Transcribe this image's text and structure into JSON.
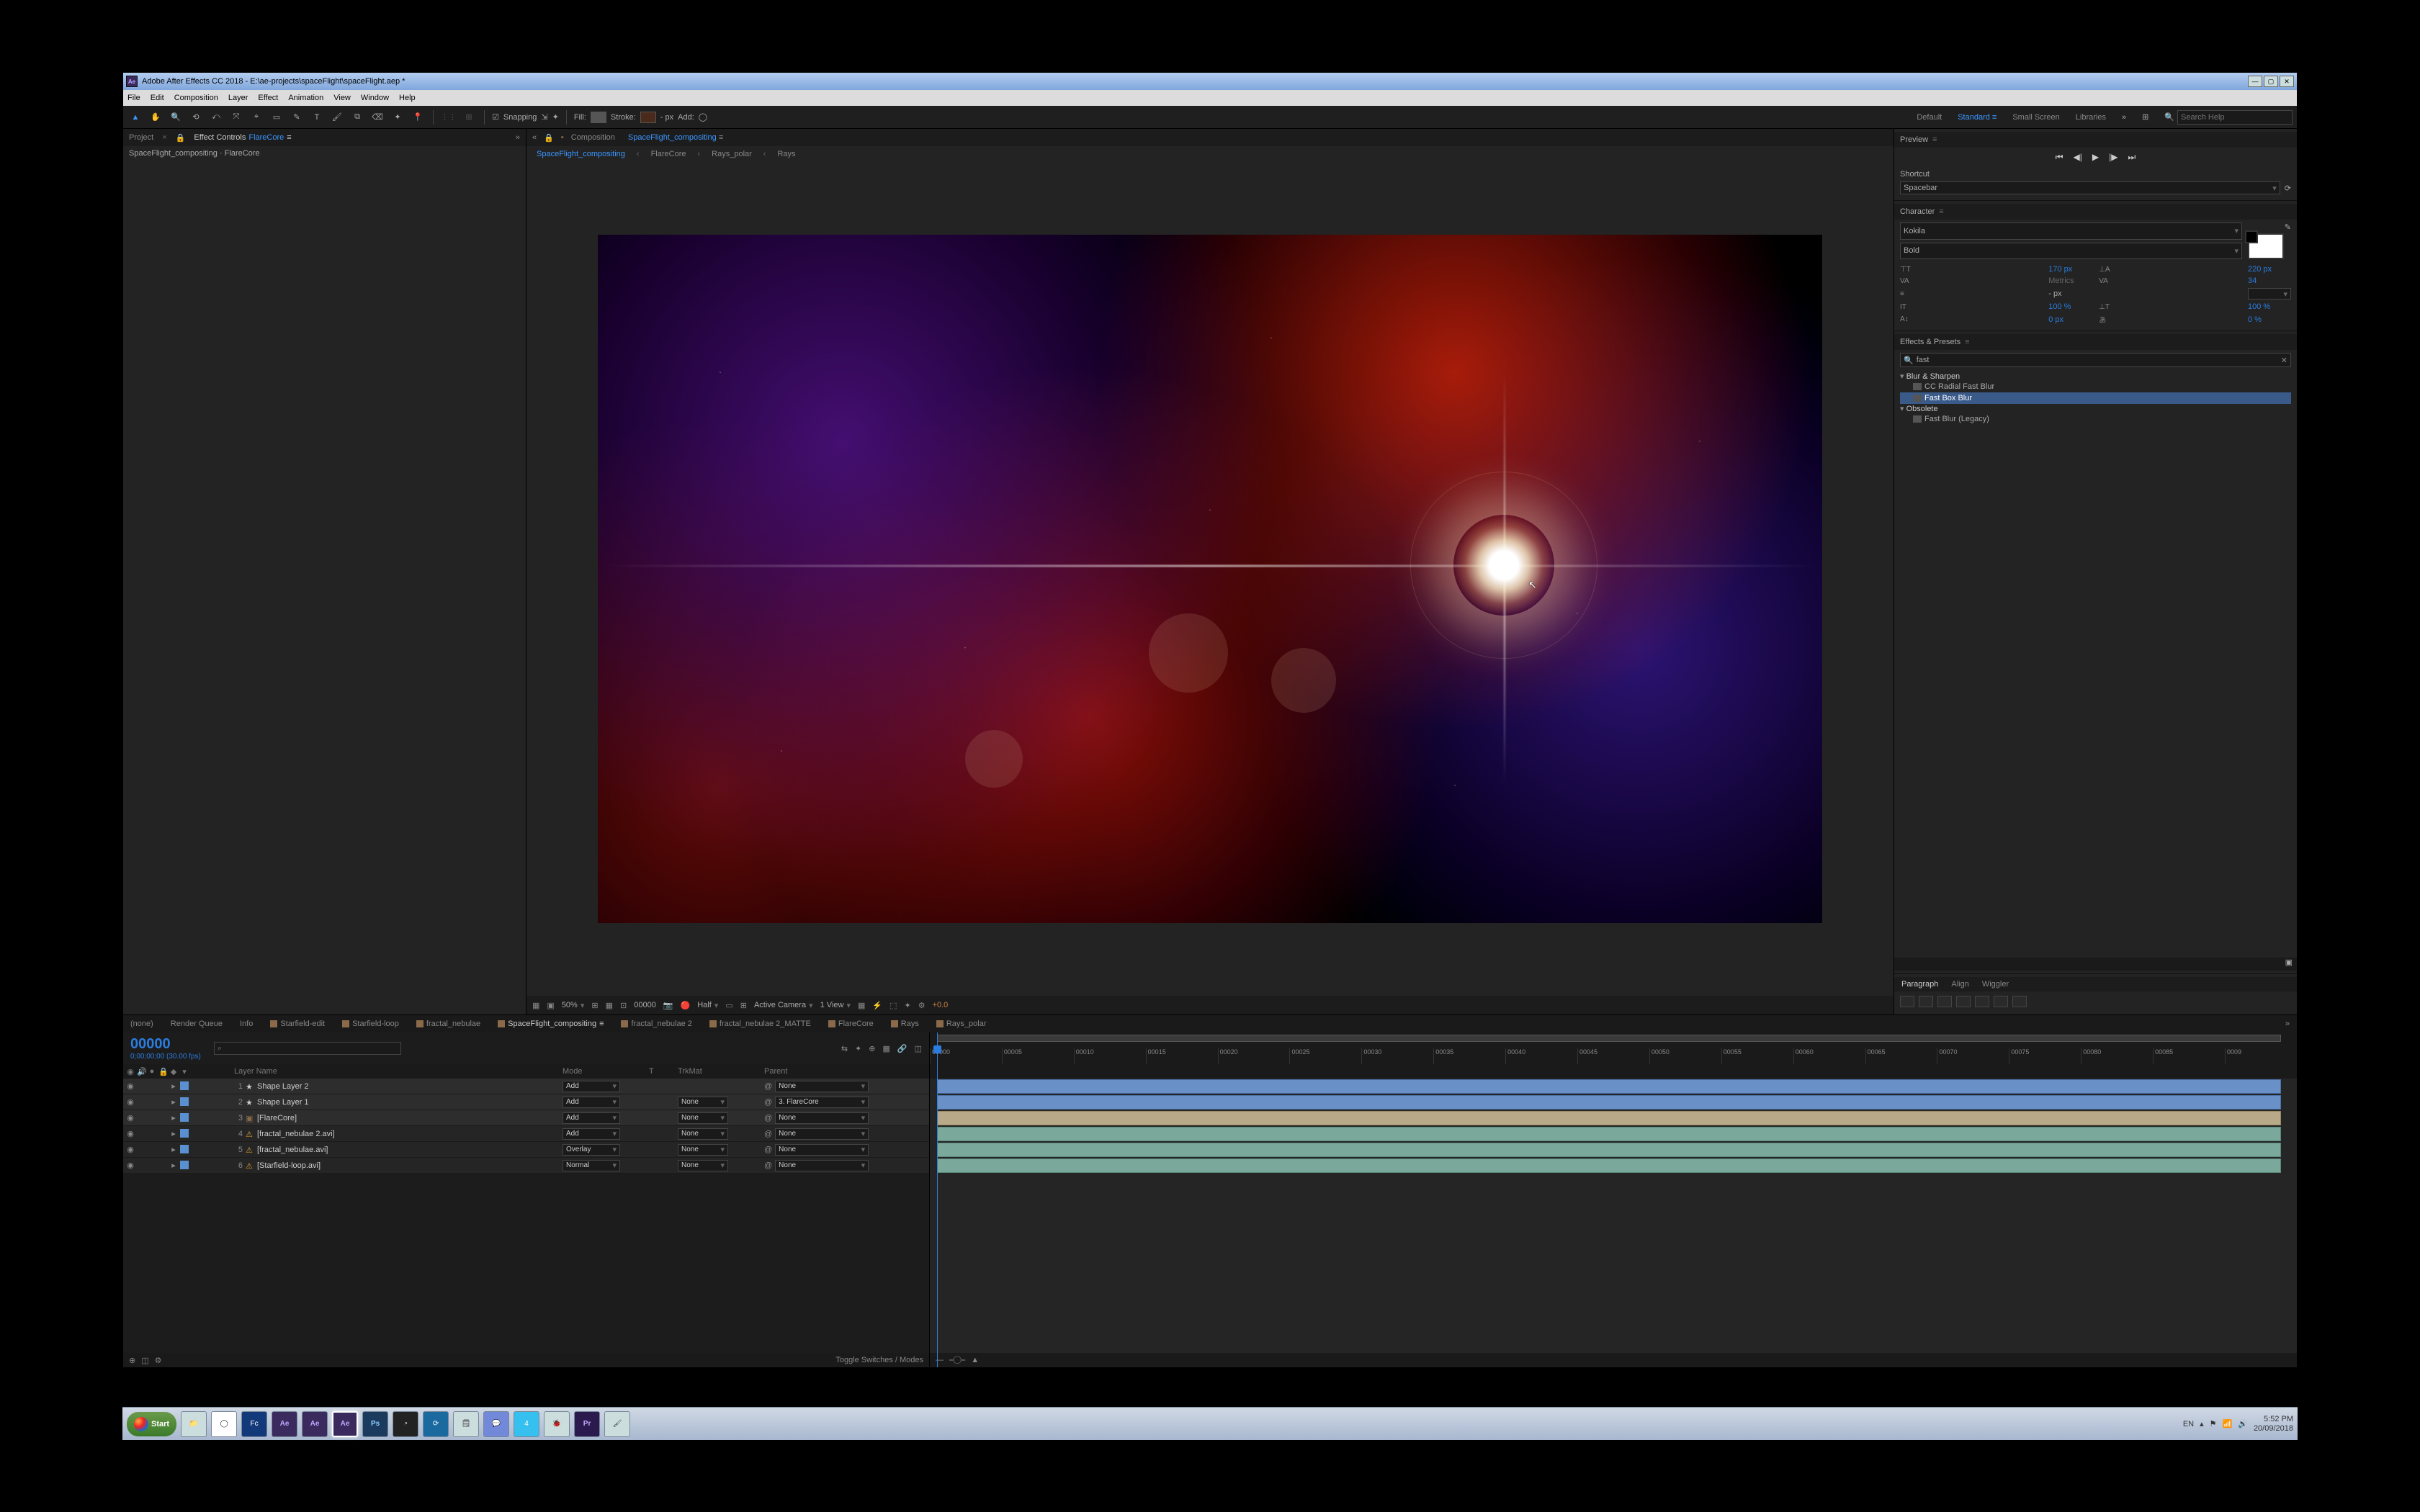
{
  "titlebar": {
    "app": "Adobe After Effects CC 2018",
    "path": "E:\\ae-projects\\spaceFlight\\spaceFlight.aep *"
  },
  "menu": [
    "File",
    "Edit",
    "Composition",
    "Layer",
    "Effect",
    "Animation",
    "View",
    "Window",
    "Help"
  ],
  "toolbar": {
    "snapping": "Snapping",
    "fill_label": "Fill:",
    "stroke_label": "Stroke:",
    "stroke_px": "- px",
    "add_label": "Add:",
    "workspaces": [
      "Default",
      "Standard",
      "Small Screen",
      "Libraries"
    ],
    "active_ws": "Standard",
    "search_placeholder": "Search Help"
  },
  "leftpanel": {
    "tabs": {
      "project": "Project",
      "fx": "Effect Controls",
      "fx_link": "FlareCore"
    },
    "path_row": "SpaceFlight_compositing · FlareCore"
  },
  "comp": {
    "label": "Composition",
    "active": "SpaceFlight_compositing",
    "breadcrumbs": [
      "SpaceFlight_compositing",
      "FlareCore",
      "Rays_polar",
      "Rays"
    ]
  },
  "viewer_footer": {
    "mag": "50%",
    "timecode": "00000",
    "res": "Half",
    "camera": "Active Camera",
    "views": "1 View",
    "exposure": "+0.0"
  },
  "preview": {
    "title": "Preview",
    "shortcut_label": "Shortcut",
    "shortcut_value": "Spacebar"
  },
  "character": {
    "title": "Character",
    "font": "Kokila",
    "style": "Bold",
    "size": "170 px",
    "leading": "220 px",
    "kerning": "Metrics",
    "tracking": "34",
    "unit": "- px",
    "vscale": "100 %",
    "hscale": "100 %",
    "baseline": "0 px",
    "tsume": "0 %"
  },
  "effects": {
    "title": "Effects & Presets",
    "query": "fast",
    "groups": [
      {
        "name": "Blur & Sharpen",
        "items": [
          "CC Radial Fast Blur",
          "Fast Box Blur"
        ],
        "selected": "Fast Box Blur"
      },
      {
        "name": "Obsolete",
        "items": [
          "Fast Blur (Legacy)"
        ]
      }
    ]
  },
  "bottom_tabs": [
    "Paragraph",
    "Align",
    "Wiggler"
  ],
  "timeline": {
    "tabs": [
      "(none)",
      "Render Queue",
      "Info",
      "Starfield-edit",
      "Starfield-loop",
      "fractal_nebulae",
      "SpaceFlight_compositing",
      "fractal_nebulae 2",
      "fractal_nebulae 2_MATTE",
      "FlareCore",
      "Rays",
      "Rays_polar"
    ],
    "active_tab": "SpaceFlight_compositing",
    "timecode": "00000",
    "framerate": "0;00;00;00 (30.00 fps)",
    "search_placeholder": "⌕",
    "col_headers": {
      "name": "Layer Name",
      "mode": "Mode",
      "t": "T",
      "trkmat": "TrkMat",
      "parent": "Parent"
    },
    "toggle_label": "Toggle Switches / Modes",
    "ticks": [
      "00000",
      "00005",
      "00010",
      "00015",
      "00020",
      "00025",
      "00030",
      "00035",
      "00040",
      "00045",
      "00050",
      "00055",
      "00060",
      "00065",
      "00070",
      "00075",
      "00080",
      "00085",
      "0009"
    ],
    "layers": [
      {
        "num": 1,
        "color": "#5a90d0",
        "icon": "star",
        "name": "Shape Layer 2",
        "mode": "Add",
        "trkmat": "",
        "parent": "None",
        "bar": "blue",
        "sel": true
      },
      {
        "num": 2,
        "color": "#5a90d0",
        "icon": "star",
        "name": "Shape Layer 1",
        "mode": "Add",
        "trkmat": "None",
        "parent": "3. FlareCore",
        "bar": "blue",
        "sel": true
      },
      {
        "num": 3,
        "color": "#5a90d0",
        "icon": "comp",
        "name": "[FlareCore]",
        "mode": "Add",
        "trkmat": "None",
        "parent": "None",
        "bar": "tan",
        "sel": true
      },
      {
        "num": 4,
        "color": "#5a90d0",
        "icon": "warn",
        "name": "[fractal_nebulae 2.avi]",
        "mode": "Add",
        "trkmat": "None",
        "parent": "None",
        "bar": "teal"
      },
      {
        "num": 5,
        "color": "#5a90d0",
        "icon": "warn",
        "name": "[fractal_nebulae.avi]",
        "mode": "Overlay",
        "trkmat": "None",
        "parent": "None",
        "bar": "teal"
      },
      {
        "num": 6,
        "color": "#5a90d0",
        "icon": "warn",
        "name": "[Starfield-loop.avi]",
        "mode": "Normal",
        "trkmat": "None",
        "parent": "None",
        "bar": "teal"
      }
    ]
  },
  "taskbar": {
    "start": "Start",
    "items": [
      {
        "id": "explorer",
        "label": "📁"
      },
      {
        "id": "chrome",
        "label": "◯",
        "bg": "#fff"
      },
      {
        "id": "fc",
        "label": "Fc",
        "bg": "#123a7a",
        "color": "#fff"
      },
      {
        "id": "ae1",
        "label": "Ae",
        "cls": "ae"
      },
      {
        "id": "ae2",
        "label": "Ae",
        "cls": "ae"
      },
      {
        "id": "ae3",
        "label": "Ae",
        "cls": "ae active"
      },
      {
        "id": "ps",
        "label": "Ps",
        "cls": "ps"
      },
      {
        "id": "obs",
        "label": "◔",
        "bg": "#222",
        "color": "#fff"
      },
      {
        "id": "ts",
        "label": "⟳",
        "bg": "#1a6aa0",
        "color": "#fff"
      },
      {
        "id": "notes",
        "label": "🗒"
      },
      {
        "id": "discord",
        "label": "💬",
        "bg": "#7289da",
        "color": "#fff"
      },
      {
        "id": "app4",
        "label": "4",
        "bg": "#35c0f0",
        "color": "#fff"
      },
      {
        "id": "bug",
        "label": "🐞"
      },
      {
        "id": "pr",
        "label": "Pr",
        "cls": "pr"
      },
      {
        "id": "brush",
        "label": "🖌"
      }
    ],
    "lang": "EN",
    "time": "5:52 PM",
    "date": "20/09/2018"
  }
}
